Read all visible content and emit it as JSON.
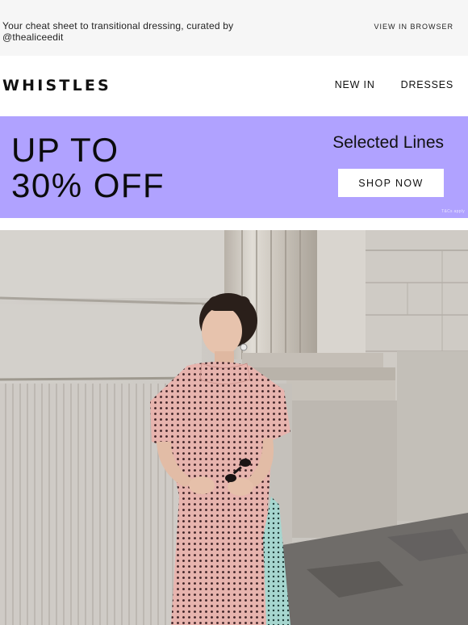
{
  "preheader": {
    "tagline": "Your cheat sheet to transitional dressing, curated by @thealiceedit",
    "view_in_browser": "VIEW IN BROWSER"
  },
  "header": {
    "logo": "WHISTLES",
    "nav": [
      "NEW IN",
      "DRESSES"
    ]
  },
  "promo": {
    "headline_line1": "UP TO",
    "headline_line2": "30% OFF",
    "subheading": "Selected Lines",
    "cta": "SHOP NOW",
    "terms": "T&Cs apply",
    "background": "#b0a2ff"
  },
  "hero": {
    "description_icon": "model-photo",
    "dress_colors": [
      "#e8b6b0",
      "#9fd0c9"
    ]
  }
}
